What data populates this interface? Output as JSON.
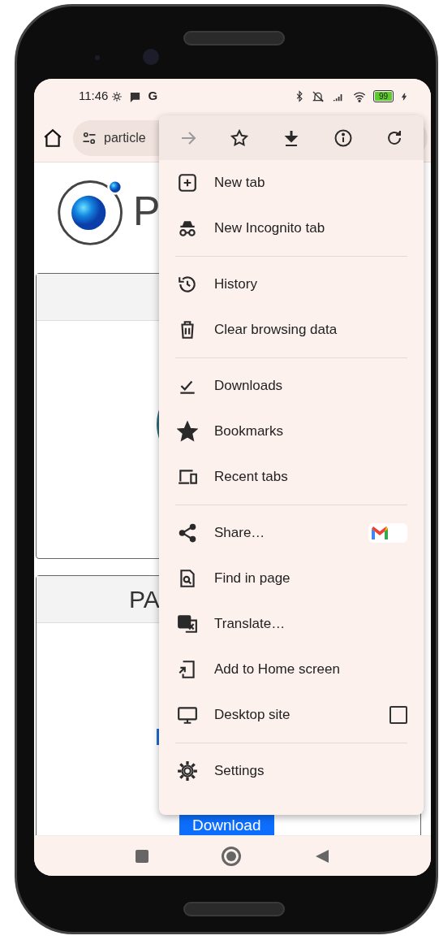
{
  "status_bar": {
    "time": "11:46",
    "carrier_glyph": "G",
    "battery": "99"
  },
  "address_bar": {
    "url": "particle"
  },
  "page": {
    "logo_text": "P",
    "card_header": "PA",
    "download_button": "Download"
  },
  "menu": {
    "toolbar": [
      {
        "kind": "forward",
        "disabled": true
      },
      {
        "kind": "star",
        "disabled": false
      },
      {
        "kind": "download",
        "disabled": false
      },
      {
        "kind": "info",
        "disabled": false
      },
      {
        "kind": "reload",
        "disabled": false
      }
    ],
    "sections": [
      [
        {
          "kind": "plain",
          "label": "New tab"
        },
        {
          "kind": "plain",
          "label": "New Incognito tab"
        }
      ],
      [
        {
          "kind": "plain",
          "label": "History"
        },
        {
          "kind": "plain",
          "label": "Clear browsing data"
        }
      ],
      [
        {
          "kind": "plain",
          "label": "Downloads"
        },
        {
          "kind": "plain",
          "label": "Bookmarks"
        },
        {
          "kind": "plain",
          "label": "Recent tabs"
        }
      ],
      [
        {
          "kind": "share",
          "label": "Share…"
        },
        {
          "kind": "plain",
          "label": "Find in page"
        },
        {
          "kind": "plain",
          "label": "Translate…"
        },
        {
          "kind": "plain",
          "label": "Add to Home screen"
        },
        {
          "kind": "checkbox",
          "label": "Desktop site",
          "checked": false
        }
      ],
      [
        {
          "kind": "plain",
          "label": "Settings"
        }
      ]
    ]
  }
}
